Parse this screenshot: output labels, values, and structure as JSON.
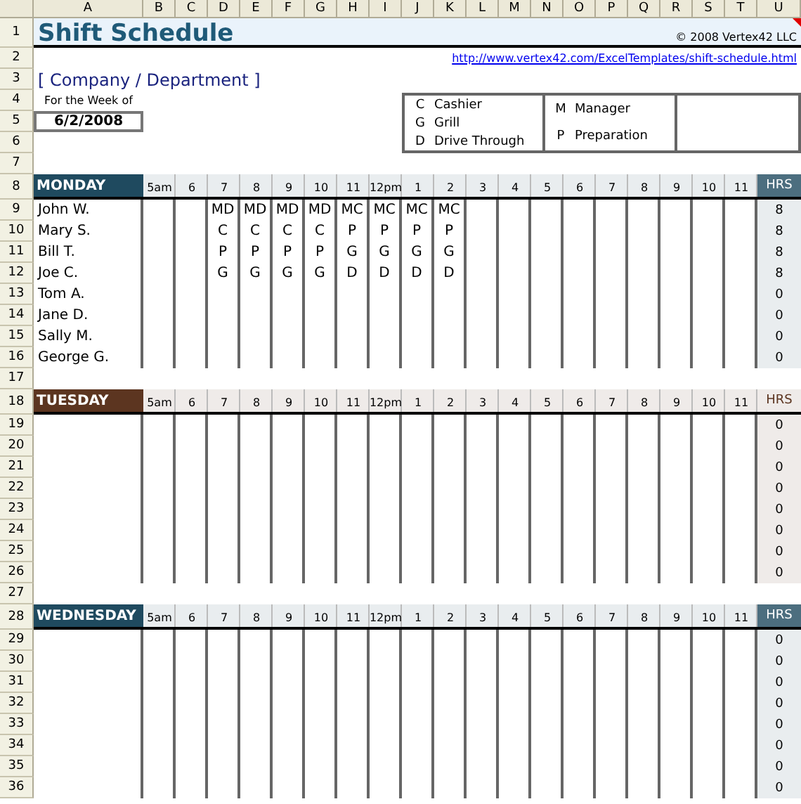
{
  "column_headers": [
    "A",
    "B",
    "C",
    "D",
    "E",
    "F",
    "G",
    "H",
    "I",
    "J",
    "K",
    "L",
    "M",
    "N",
    "O",
    "P",
    "Q",
    "R",
    "S",
    "T",
    "U"
  ],
  "row_numbers": [
    "1",
    "2",
    "3",
    "4",
    "5",
    "6",
    "7",
    "8",
    "9",
    "10",
    "11",
    "12",
    "13",
    "14",
    "15",
    "16",
    "17",
    "18",
    "19",
    "20",
    "21",
    "22",
    "23",
    "24",
    "25",
    "26",
    "27",
    "28",
    "29",
    "30",
    "31",
    "32",
    "33",
    "34",
    "35",
    "36"
  ],
  "title": "Shift Schedule",
  "copyright": "© 2008 Vertex42 LLC",
  "link": "http://www.vertex42.com/ExcelTemplates/shift-schedule.html",
  "company": "[ Company / Department ]",
  "week_label": "For the Week of",
  "week_date": "6/2/2008",
  "legend": [
    [
      {
        "code": "C",
        "label": "Cashier"
      },
      {
        "code": "G",
        "label": "Grill"
      },
      {
        "code": "D",
        "label": "Drive Through"
      }
    ],
    [
      {
        "code": "M",
        "label": "Manager"
      },
      {
        "code": "P",
        "label": "Preparation"
      }
    ]
  ],
  "days": [
    {
      "name": "MONDAY",
      "color": "#1f4a5f",
      "hrs_header_filled": true,
      "hrs_label": "HRS",
      "hours": [
        {
          "label": "5am"
        },
        {
          "label": "6"
        },
        {
          "label": "7",
          "codes": [
            "MD",
            "C",
            "P",
            "G"
          ]
        },
        {
          "label": "8",
          "codes": [
            "MD",
            "C",
            "P",
            "G"
          ]
        },
        {
          "label": "9",
          "codes": [
            "MD",
            "C",
            "P",
            "G"
          ]
        },
        {
          "label": "10",
          "codes": [
            "MD",
            "C",
            "P",
            "G"
          ]
        },
        {
          "label": "11",
          "codes": [
            "MC",
            "P",
            "G",
            "D"
          ]
        },
        {
          "label": "12pm",
          "codes": [
            "MC",
            "P",
            "G",
            "D"
          ]
        },
        {
          "label": "1",
          "codes": [
            "MC",
            "P",
            "G",
            "D"
          ]
        },
        {
          "label": "2",
          "codes": [
            "MC",
            "P",
            "G",
            "D"
          ]
        },
        {
          "label": "3"
        },
        {
          "label": "4"
        },
        {
          "label": "5"
        },
        {
          "label": "6"
        },
        {
          "label": "7"
        },
        {
          "label": "8"
        },
        {
          "label": "9"
        },
        {
          "label": "10"
        },
        {
          "label": "11"
        }
      ],
      "employees": [
        {
          "name": "John W.",
          "hrs": "8"
        },
        {
          "name": "Mary S.",
          "hrs": "8"
        },
        {
          "name": "Bill T.",
          "hrs": "8"
        },
        {
          "name": "Joe C.",
          "hrs": "8"
        },
        {
          "name": "Tom A.",
          "hrs": "0"
        },
        {
          "name": "Jane D.",
          "hrs": "0"
        },
        {
          "name": "Sally M.",
          "hrs": "0"
        },
        {
          "name": "George G.",
          "hrs": "0"
        }
      ]
    },
    {
      "name": "TUESDAY",
      "color": "#5c3520",
      "hrs_header_filled": false,
      "hrs_label": "HRS",
      "hours": [
        {
          "label": "5am"
        },
        {
          "label": "6"
        },
        {
          "label": "7"
        },
        {
          "label": "8"
        },
        {
          "label": "9"
        },
        {
          "label": "10"
        },
        {
          "label": "11"
        },
        {
          "label": "12pm"
        },
        {
          "label": "1"
        },
        {
          "label": "2"
        },
        {
          "label": "3"
        },
        {
          "label": "4"
        },
        {
          "label": "5"
        },
        {
          "label": "6"
        },
        {
          "label": "7"
        },
        {
          "label": "8"
        },
        {
          "label": "9"
        },
        {
          "label": "10"
        },
        {
          "label": "11"
        }
      ],
      "employees": [
        {
          "hrs": "0"
        },
        {
          "hrs": "0"
        },
        {
          "hrs": "0"
        },
        {
          "hrs": "0"
        },
        {
          "hrs": "0"
        },
        {
          "hrs": "0"
        },
        {
          "hrs": "0"
        },
        {
          "hrs": "0"
        }
      ]
    },
    {
      "name": "WEDNESDAY",
      "color": "#1f4a5f",
      "hrs_header_filled": true,
      "hrs_label": "HRS",
      "hours": [
        {
          "label": "5am"
        },
        {
          "label": "6"
        },
        {
          "label": "7"
        },
        {
          "label": "8"
        },
        {
          "label": "9"
        },
        {
          "label": "10"
        },
        {
          "label": "11"
        },
        {
          "label": "12pm"
        },
        {
          "label": "1"
        },
        {
          "label": "2"
        },
        {
          "label": "3"
        },
        {
          "label": "4"
        },
        {
          "label": "5"
        },
        {
          "label": "6"
        },
        {
          "label": "7"
        },
        {
          "label": "8"
        },
        {
          "label": "9"
        },
        {
          "label": "10"
        },
        {
          "label": "11"
        }
      ],
      "employees": [
        {
          "hrs": "0"
        },
        {
          "hrs": "0"
        },
        {
          "hrs": "0"
        },
        {
          "hrs": "0"
        },
        {
          "hrs": "0"
        },
        {
          "hrs": "0"
        },
        {
          "hrs": "0"
        },
        {
          "hrs": "0"
        }
      ]
    }
  ]
}
